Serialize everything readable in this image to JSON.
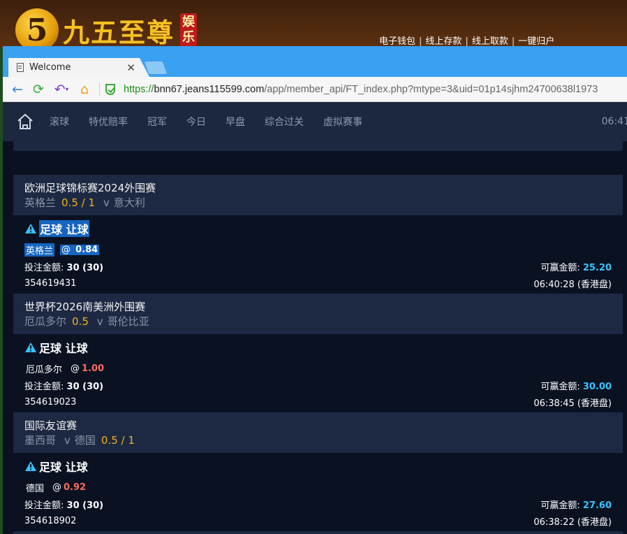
{
  "site": {
    "logo_glyph": "5",
    "logo_text": "九五至尊",
    "logo_tag": "娱乐",
    "links": [
      "电子钱包",
      "线上存款",
      "线上取款",
      "一键归户"
    ]
  },
  "browser": {
    "tab_title": "Welcome",
    "url_scheme": "https://",
    "url_host": "bnn67.jeans115599.com",
    "url_path": "/app/member_api/FT_index.php?mtype=3&uid=01p14sjhm24700638l1973"
  },
  "nav": {
    "items": [
      "滚球",
      "特优赔率",
      "冠军",
      "今日",
      "早盘",
      "综合过关",
      "虚拟赛事"
    ],
    "clock": "06:41"
  },
  "bets": [
    {
      "league": "欧洲足球锦标赛2024外围赛",
      "home": "英格兰",
      "handicap": "0.5 / 1",
      "vs": "v",
      "away": "意大利",
      "bet_type": "足球 让球",
      "pick_team": "英格兰",
      "at": "@",
      "odds": "0.84",
      "stake_label": "投注金额:",
      "stake": "30 (30)",
      "win_label": "可赢金额:",
      "win": "25.20",
      "ticket": "354619431",
      "time": "06:40:28 (香港盘)"
    },
    {
      "league": "世界杯2026南美洲外围赛",
      "home": "厄瓜多尔",
      "handicap": "0.5",
      "vs": "v",
      "away": "哥伦比亚",
      "bet_type": "足球 让球",
      "pick_team": "厄瓜多尔",
      "at": "@",
      "odds": "1.00",
      "stake_label": "投注金额:",
      "stake": "30 (30)",
      "win_label": "可赢金额:",
      "win": "30.00",
      "ticket": "354619023",
      "time": "06:38:45 (香港盘)"
    },
    {
      "league": "国际友谊赛",
      "home": "墨西哥",
      "vs": "v",
      "away": "德国",
      "handicap": "0.5 / 1",
      "bet_type": "足球 让球",
      "pick_team": "德国",
      "at": "@",
      "odds": "0.92",
      "stake_label": "投注金额:",
      "stake": "30 (30)",
      "win_label": "可赢金额:",
      "win": "27.60",
      "ticket": "354618902",
      "time": "06:38:22 (香港盘)"
    }
  ],
  "colors": {
    "accent_blue": "#37c4ff",
    "odds_red": "#ff6b5b",
    "handicap_gold": "#f0b11e",
    "selection": "#1665c1"
  }
}
